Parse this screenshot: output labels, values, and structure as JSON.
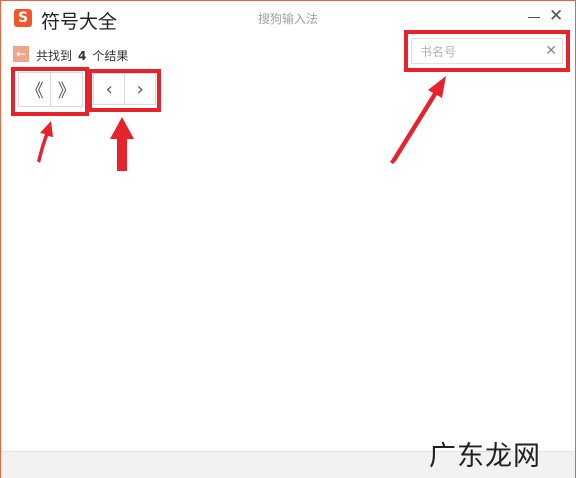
{
  "window": {
    "logo_letter": "S",
    "app_title": "符号大全",
    "center_title": "搜狗输入法",
    "close_glyph": "✕"
  },
  "results": {
    "back_glyph": "←",
    "prefix": "共找到",
    "count": "4",
    "suffix": "个结果"
  },
  "pagination": {
    "first_glyph": "《",
    "last_glyph": "》",
    "prev_glyph": "‹",
    "next_glyph": "›"
  },
  "search": {
    "placeholder": "书名号",
    "value": "",
    "clear_glyph": "✕"
  },
  "watermark": "广东龙网",
  "colors": {
    "accent": "#f0582b",
    "annotation_red": "#e6232d",
    "window_border": "#e8643a"
  }
}
